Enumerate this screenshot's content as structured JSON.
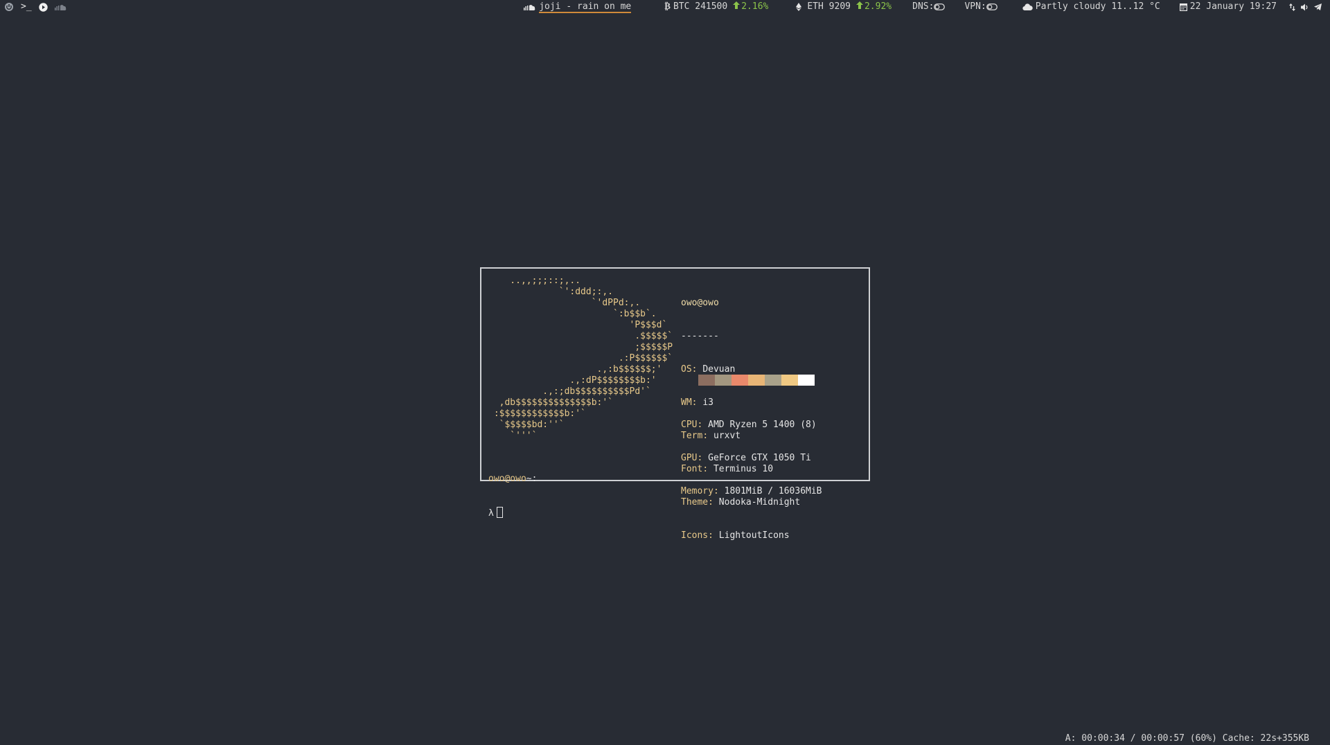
{
  "topbar": {
    "left_icons": [
      "power-icon",
      "terminal-icon",
      "play-icon",
      "music-cloud-icon"
    ],
    "now_playing": {
      "icon": "music-cloud-icon",
      "text": "joji - rain on me"
    },
    "btc": {
      "icon": "bitcoin-icon",
      "label": "BTC 241500",
      "change": "2.16%"
    },
    "eth": {
      "icon": "ethereum-icon",
      "label": "ETH 9209",
      "change": "2.92%"
    },
    "dns": {
      "label": "DNS:",
      "icon": "toggle-icon"
    },
    "vpn": {
      "label": "VPN:",
      "icon": "toggle-icon"
    },
    "weather": {
      "icon": "cloud-icon",
      "text": "Partly cloudy 11..12 °C"
    },
    "date": {
      "icon": "calendar-icon",
      "text": "22 January 19:27"
    },
    "tray_icons": [
      "network-icon",
      "volume-icon",
      "telegram-icon"
    ],
    "accent_color": "#d08a3a",
    "positive_color": "#8bc34a"
  },
  "terminal": {
    "ascii_art": "    ..,,;;;::;,..\n             `':ddd;:,.\n                   `'dPPd:,.\n                       `:b$$b`.\n                          'P$$$d`\n                           .$$$$$`\n                           ;$$$$$P\n                        .:P$$$$$$`\n                    .,:b$$$$$$;'\n               .,:dP$$$$$$$$b:'\n          .,:;db$$$$$$$$$$Pd'`\n  ,db$$$$$$$$$$$$$$b:'`\n :$$$$$$$$$$$$b:'`\n  `$$$$$bd:''`\n    `'''`",
    "info_title": "owo@owo",
    "separator": "-------",
    "info": [
      {
        "key": "OS",
        "value": "Devuan"
      },
      {
        "key": "WM",
        "value": "i3"
      },
      {
        "key": "Term",
        "value": "urxvt"
      },
      {
        "key": "Font",
        "value": "Terminus 10"
      },
      {
        "key": "Theme",
        "value": "Nodoka-Midnight"
      },
      {
        "key": "Icons",
        "value": "LightoutIcons"
      }
    ],
    "palette": [
      "#8c6e60",
      "#a39780",
      "#e9896b",
      "#e8b576",
      "#a9a28a",
      "#f0c983",
      "#ffffff"
    ],
    "hardware": [
      {
        "key": "CPU",
        "value": "AMD Ryzen 5 1400 (8)"
      },
      {
        "key": "GPU",
        "value": "GeForce GTX 1050 Ti"
      },
      {
        "key": "Memory",
        "value": "1801MiB / 16036MiB"
      }
    ],
    "prompt_user": "owo@owo",
    "prompt_path": "~:",
    "prompt_symbol": "λ"
  },
  "status_bar": {
    "text": "A: 00:00:34 / 00:00:57 (60%) Cache: 22s+355KB"
  }
}
